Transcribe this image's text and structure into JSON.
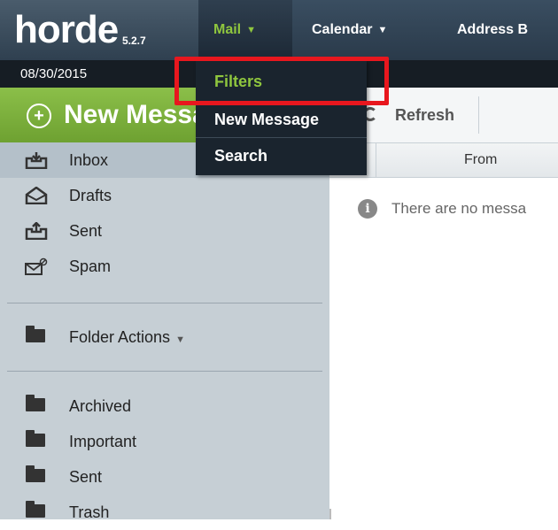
{
  "app": {
    "logo_word": "horde",
    "version": "5.2.7"
  },
  "topnav": {
    "items": [
      {
        "label": "Mail",
        "active": true
      },
      {
        "label": "Calendar",
        "active": false
      },
      {
        "label": "Address B",
        "active": false
      }
    ]
  },
  "date": "08/30/2015",
  "dropdown": {
    "items": [
      "Filters",
      "New Message",
      "Search"
    ]
  },
  "new_message_label": "New Messa",
  "folders": {
    "system": [
      "Inbox",
      "Drafts",
      "Sent",
      "Spam"
    ],
    "folder_actions_label": "Folder Actions",
    "user": [
      "Archived",
      "Important",
      "Sent",
      "Trash"
    ]
  },
  "toolbar": {
    "refresh_label": "Refresh"
  },
  "list": {
    "from_header": "From",
    "empty_message": "There are no messa"
  },
  "colors": {
    "accent_green": "#8fc63e",
    "highlight_red": "#e8171e"
  }
}
